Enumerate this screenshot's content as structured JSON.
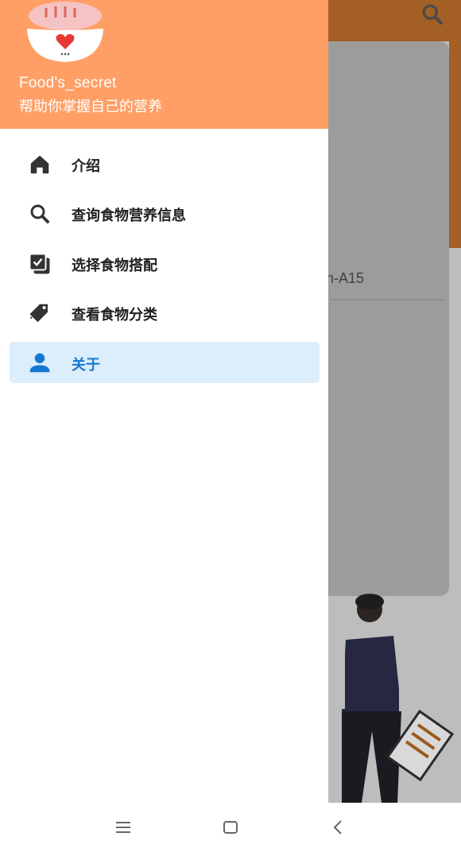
{
  "header": {
    "app_name": "Food's_secret",
    "subtitle": "帮助你掌握自己的营养"
  },
  "menu": {
    "items": [
      {
        "label": "介绍",
        "icon": "home-icon",
        "active": false
      },
      {
        "label": "查询食物营养信息",
        "icon": "search-icon",
        "active": false
      },
      {
        "label": "选择食物搭配",
        "icon": "checklist-icon",
        "active": false
      },
      {
        "label": "查看食物分类",
        "icon": "tag-icon",
        "active": false
      },
      {
        "label": "关于",
        "icon": "person-icon",
        "active": true
      }
    ]
  },
  "background": {
    "card_text": "n-A15"
  },
  "colors": {
    "header_bg": "#ff9f66",
    "active_bg": "#dcedfb",
    "active_text": "#1677d2"
  }
}
